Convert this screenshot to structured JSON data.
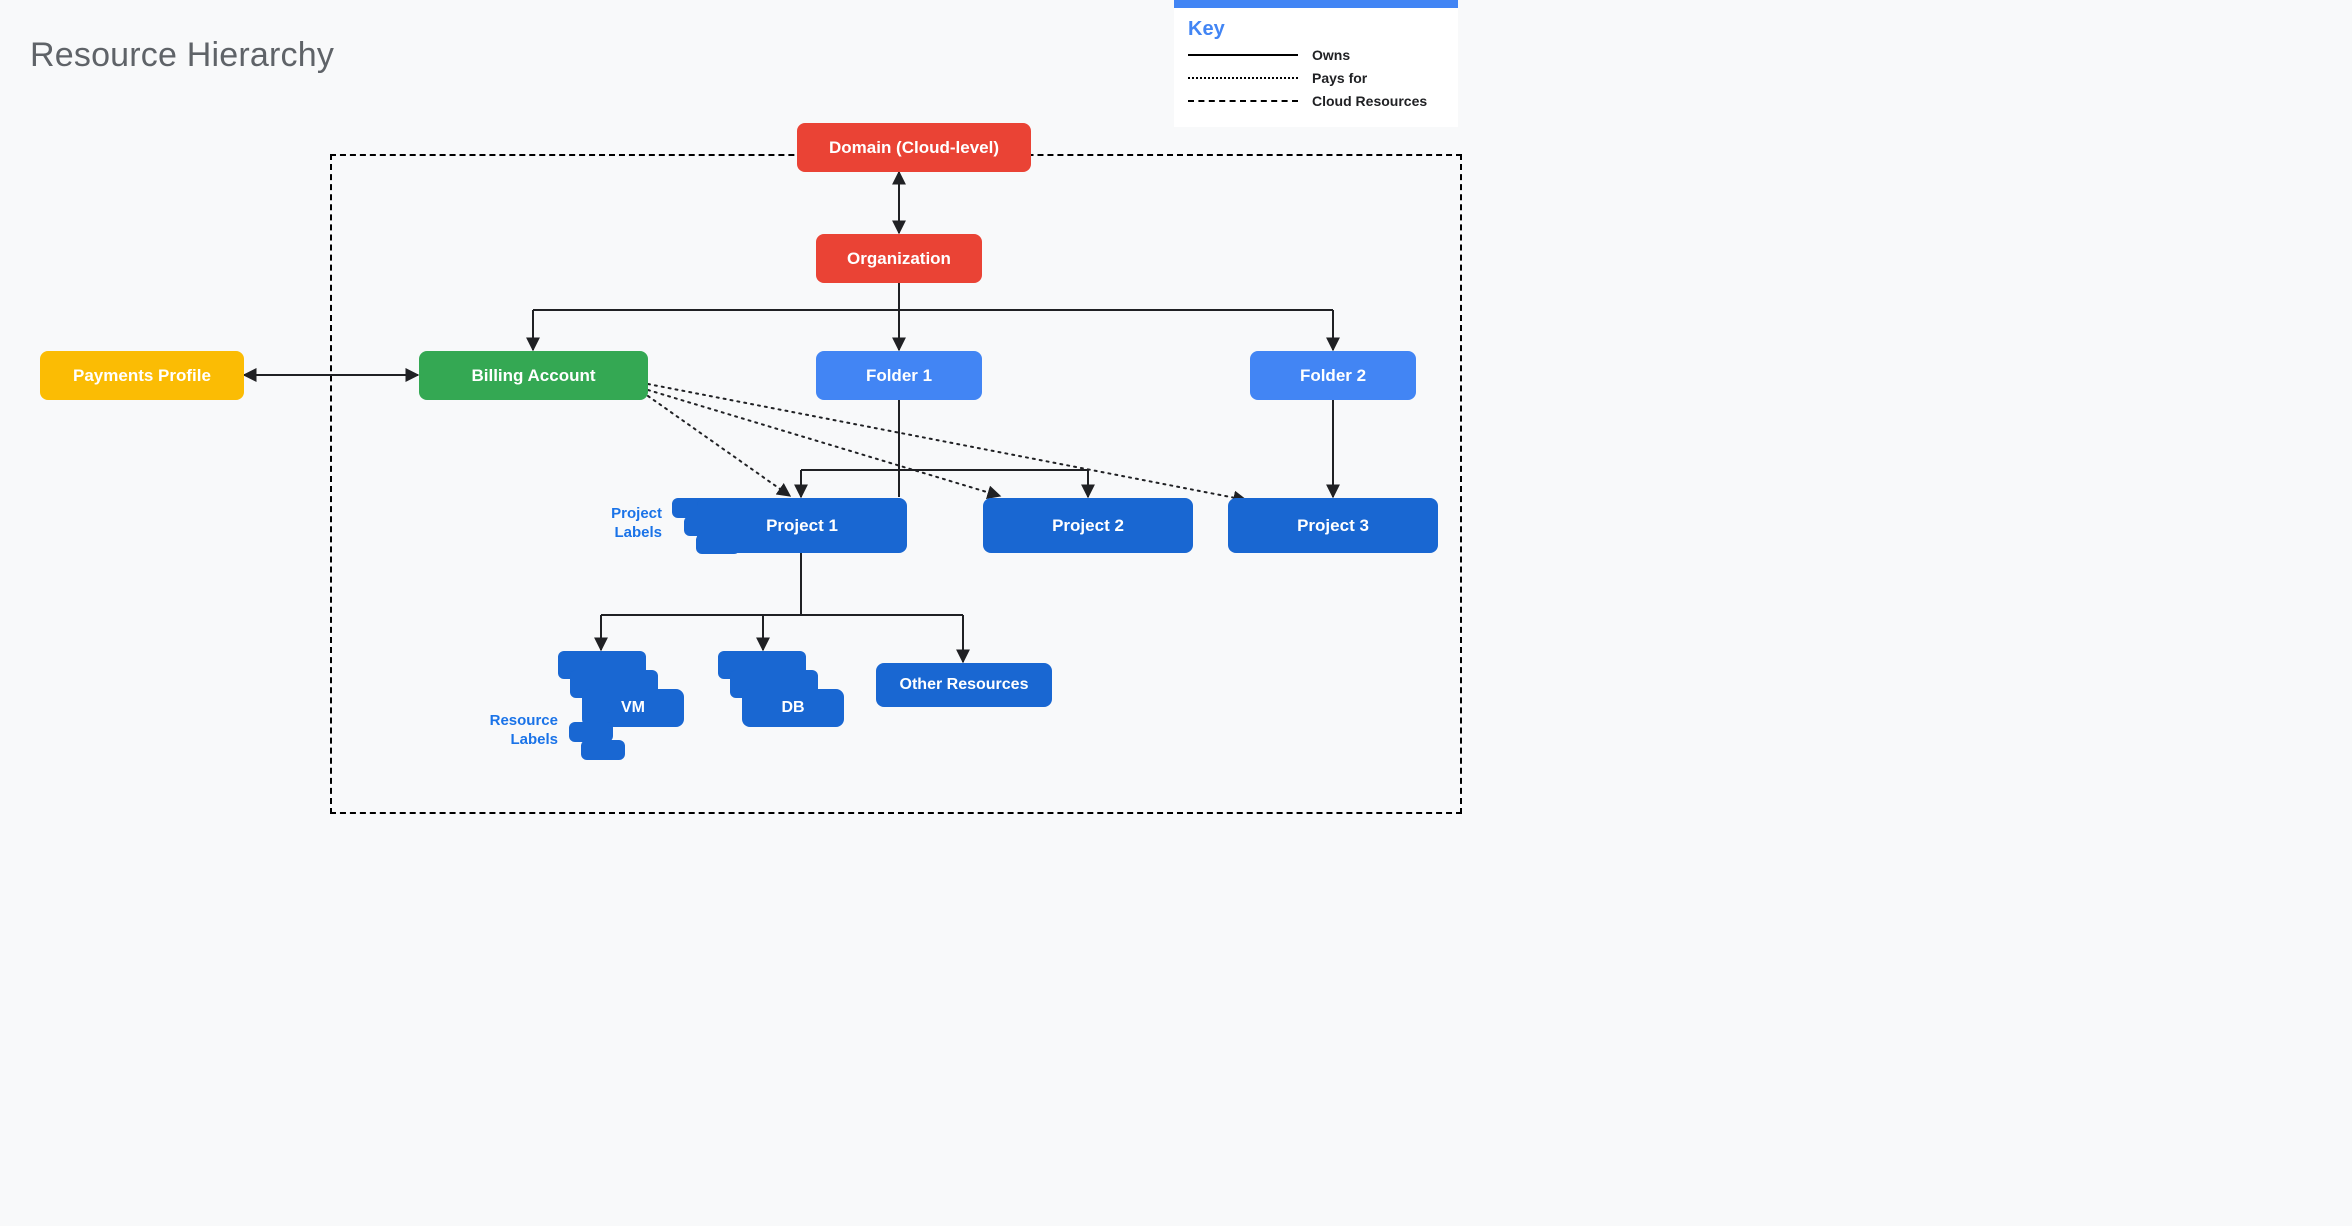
{
  "title": "Resource Hierarchy",
  "legend": {
    "title": "Key",
    "items": [
      {
        "style": "solid",
        "label": "Owns"
      },
      {
        "style": "dotted",
        "label": "Pays for"
      },
      {
        "style": "dashed",
        "label": "Cloud Resources"
      }
    ]
  },
  "nodes": {
    "domain": {
      "label": "Domain (Cloud-level)"
    },
    "organization": {
      "label": "Organization"
    },
    "payments": {
      "label": "Payments Profile"
    },
    "billing": {
      "label": "Billing Account"
    },
    "folder1": {
      "label": "Folder 1"
    },
    "folder2": {
      "label": "Folder 2"
    },
    "project1": {
      "label": "Project 1"
    },
    "project2": {
      "label": "Project 2"
    },
    "project3": {
      "label": "Project 3"
    },
    "vm": {
      "label": "VM"
    },
    "db": {
      "label": "DB"
    },
    "other": {
      "label": "Other Resources"
    }
  },
  "labels": {
    "project_labels": "Project\nLabels",
    "resource_labels": "Resource\nLabels"
  }
}
